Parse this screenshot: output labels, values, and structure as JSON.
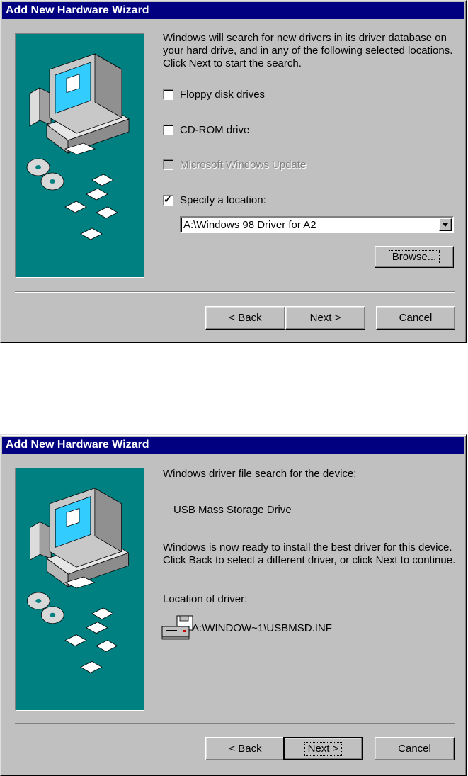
{
  "dialog1": {
    "title": "Add New Hardware Wizard",
    "intro": "Windows will search for new drivers in its driver database on your hard drive, and in any of the following selected locations. Click Next to start the search.",
    "options": [
      {
        "label": "Floppy disk drives",
        "checked": false,
        "disabled": false
      },
      {
        "label": "CD-ROM drive",
        "checked": false,
        "disabled": false
      },
      {
        "label": "Microsoft Windows Update",
        "checked": false,
        "disabled": true
      },
      {
        "label": "Specify a location:",
        "checked": true,
        "disabled": false
      }
    ],
    "location_value": "A:\\Windows 98 Driver for A2",
    "browse_label": "Browse...",
    "back_label": "< Back",
    "next_label": "Next >",
    "cancel_label": "Cancel"
  },
  "dialog2": {
    "title": "Add New Hardware Wizard",
    "search_heading": "Windows driver file search for the device:",
    "device_name": "USB Mass Storage Drive",
    "ready_text": "Windows is now ready to install the best driver for this device. Click Back to select a different driver, or click Next to continue.",
    "location_heading": "Location of driver:",
    "driver_path": "A:\\WINDOW~1\\USBMSD.INF",
    "back_label": "< Back",
    "next_label": "Next >",
    "cancel_label": "Cancel"
  },
  "icons": {
    "wizard_art": "computer-with-disks-illustration",
    "driver": "floppy-drive-icon",
    "combo_arrow": "triangle-down-icon",
    "checkbox_mark": "checkmark-icon"
  },
  "colors": {
    "titlebar": "#000080",
    "face": "#c0c0c0",
    "art_background": "#008080"
  }
}
